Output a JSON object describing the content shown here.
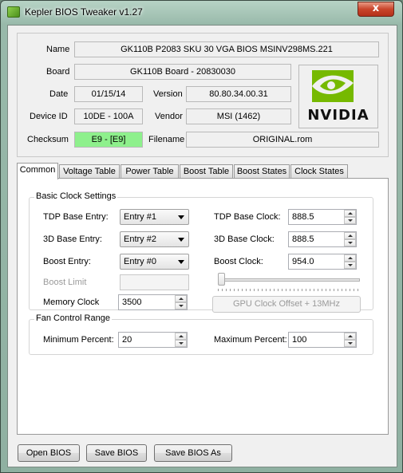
{
  "window": {
    "title": "Kepler BIOS Tweaker v1.27",
    "close_glyph": "x"
  },
  "info": {
    "name_label": "Name",
    "name_value": "GK110B P2083 SKU 30 VGA BIOS MSINV298MS.221",
    "board_label": "Board",
    "board_value": "GK110B Board - 20830030",
    "date_label": "Date",
    "date_value": "01/15/14",
    "version_label": "Version",
    "version_value": "80.80.34.00.31",
    "device_label": "Device ID",
    "device_value": "10DE - 100A",
    "vendor_label": "Vendor",
    "vendor_value": "MSI (1462)",
    "checksum_label": "Checksum",
    "checksum_value": "E9 - [E9]",
    "filename_label": "Filename",
    "filename_value": "ORIGINAL.rom",
    "logo_text": "NVIDIA",
    "logo_color": "#76b900"
  },
  "tabs": [
    {
      "label": "Common",
      "active": true
    },
    {
      "label": "Voltage Table"
    },
    {
      "label": "Power Table"
    },
    {
      "label": "Boost Table"
    },
    {
      "label": "Boost States"
    },
    {
      "label": "Clock States"
    }
  ],
  "basic": {
    "title": "Basic Clock Settings",
    "tdp_entry_label": "TDP Base Entry:",
    "tdp_entry_value": "Entry #1",
    "td3_entry_label": "3D Base Entry:",
    "td3_entry_value": "Entry #2",
    "boost_entry_label": "Boost Entry:",
    "boost_entry_value": "Entry #0",
    "boost_limit_label": "Boost Limit",
    "memory_clock_label": "Memory Clock",
    "memory_clock_value": "3500",
    "tdp_clock_label": "TDP Base Clock:",
    "tdp_clock_value": "888.5",
    "td3_clock_label": "3D Base Clock:",
    "td3_clock_value": "888.5",
    "boost_clock_label": "Boost Clock:",
    "boost_clock_value": "954.0",
    "offset_button": "GPU Clock Offset + 13MHz",
    "offset_slider_level": 0
  },
  "fan": {
    "title": "Fan Control Range",
    "min_label": "Minimum Percent:",
    "min_value": "20",
    "max_label": "Maximum Percent:",
    "max_value": "100"
  },
  "buttons": {
    "open": "Open BIOS",
    "save": "Save BIOS",
    "save_as": "Save BIOS As"
  }
}
